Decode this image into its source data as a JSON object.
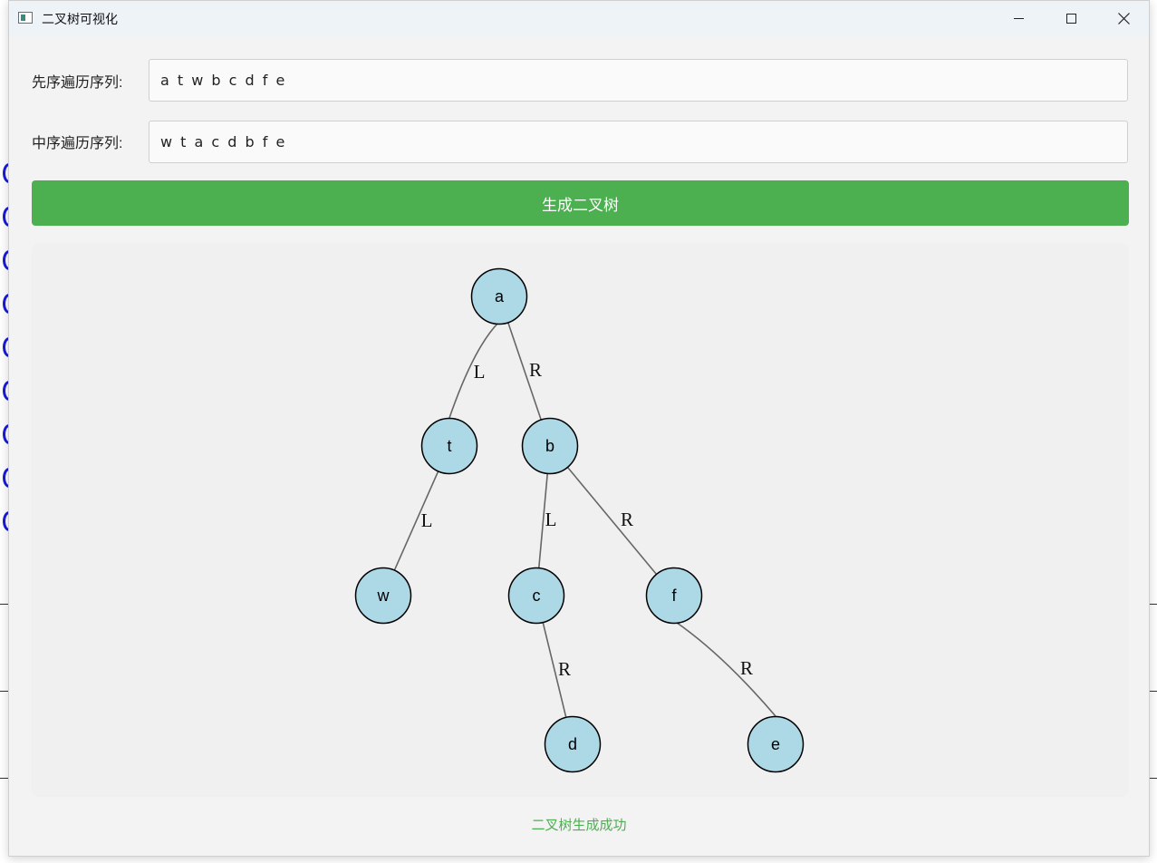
{
  "window": {
    "title": "二叉树可视化",
    "controls": {
      "minimize": "minimize-icon",
      "maximize": "maximize-icon",
      "close": "close-icon"
    }
  },
  "form": {
    "preorder_label": "先序遍历序列:",
    "preorder_value": "a t w b c d f e",
    "inorder_label": "中序遍历序列:",
    "inorder_value": "w t a c d b f e",
    "generate_label": "生成二叉树"
  },
  "tree": {
    "nodes": [
      {
        "id": "a",
        "label": "a",
        "depth": 0
      },
      {
        "id": "t",
        "label": "t",
        "depth": 1
      },
      {
        "id": "b",
        "label": "b",
        "depth": 1
      },
      {
        "id": "w",
        "label": "w",
        "depth": 2
      },
      {
        "id": "c",
        "label": "c",
        "depth": 2
      },
      {
        "id": "f",
        "label": "f",
        "depth": 2
      },
      {
        "id": "d",
        "label": "d",
        "depth": 3
      },
      {
        "id": "e",
        "label": "e",
        "depth": 3
      }
    ],
    "edges": [
      {
        "from": "a",
        "to": "t",
        "label": "L"
      },
      {
        "from": "a",
        "to": "b",
        "label": "R"
      },
      {
        "from": "t",
        "to": "w",
        "label": "L"
      },
      {
        "from": "b",
        "to": "c",
        "label": "L"
      },
      {
        "from": "b",
        "to": "f",
        "label": "R"
      },
      {
        "from": "c",
        "to": "d",
        "label": "R"
      },
      {
        "from": "f",
        "to": "e",
        "label": "R"
      }
    ],
    "node_fill": "#add8e6",
    "node_stroke": "#000000",
    "edge_color": "#666666"
  },
  "status": {
    "message": "二叉树生成成功",
    "color": "#4caf50"
  },
  "colors": {
    "accent": "#4caf50",
    "window_bg": "#f3f3f3",
    "canvas_bg": "#f0f0f0"
  }
}
